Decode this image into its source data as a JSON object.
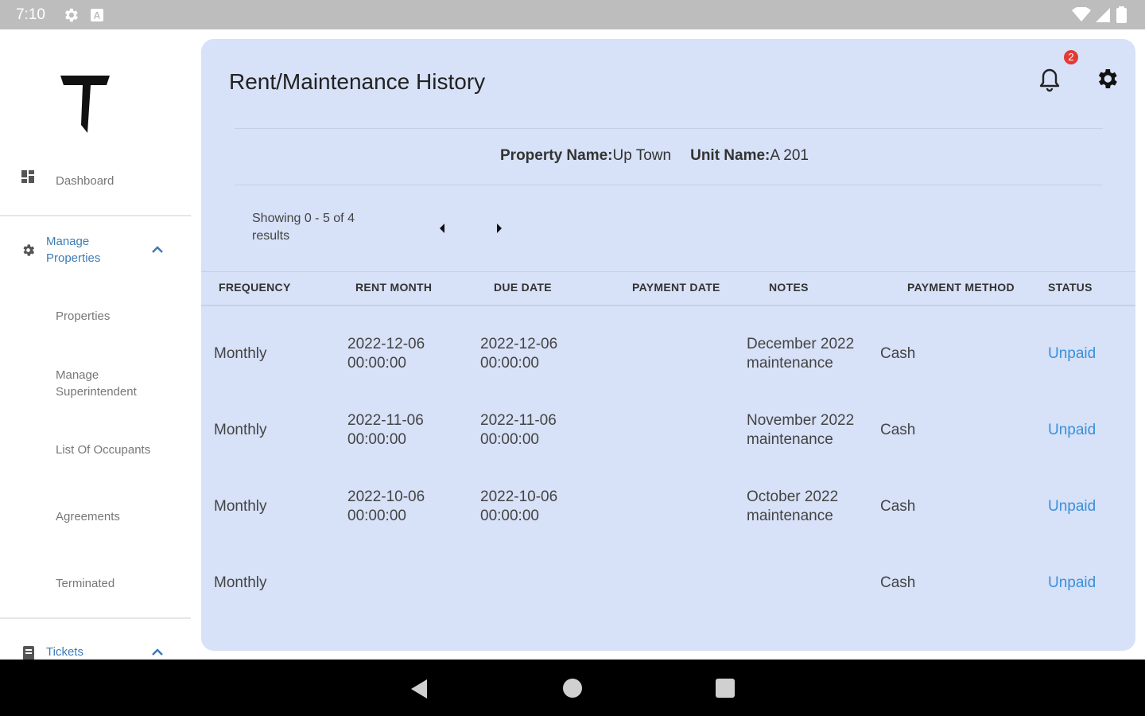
{
  "status_bar": {
    "time": "7:10"
  },
  "sidebar": {
    "dashboard": "Dashboard",
    "manage_properties": "Manage Properties",
    "sub_items": [
      "Properties",
      "Manage Superintendent",
      "List Of Occupants",
      "Agreements",
      "Terminated"
    ],
    "tickets": "Tickets"
  },
  "header": {
    "title": "Rent/Maintenance History",
    "notification_count": "2"
  },
  "info": {
    "property_label": "Property Name:",
    "property_value": "Up Town",
    "unit_label": "Unit Name:",
    "unit_value": "A 201"
  },
  "pagination": {
    "showing": "Showing 0 - 5 of 4 results"
  },
  "table": {
    "columns": [
      "FREQUENCY",
      "RENT MONTH",
      "DUE DATE",
      "PAYMENT DATE",
      "NOTES",
      "PAYMENT METHOD",
      "STATUS"
    ],
    "rows": [
      {
        "frequency": "Monthly",
        "rent_month": "2022-12-06 00:00:00",
        "due_date": "2022-12-06 00:00:00",
        "payment_date": "",
        "notes": "December 2022 maintenance",
        "method": "Cash",
        "status": "Unpaid"
      },
      {
        "frequency": "Monthly",
        "rent_month": "2022-11-06 00:00:00",
        "due_date": "2022-11-06 00:00:00",
        "payment_date": "",
        "notes": "November 2022 maintenance",
        "method": "Cash",
        "status": "Unpaid"
      },
      {
        "frequency": "Monthly",
        "rent_month": "2022-10-06 00:00:00",
        "due_date": "2022-10-06 00:00:00",
        "payment_date": "",
        "notes": "October 2022 maintenance",
        "method": "Cash",
        "status": "Unpaid"
      },
      {
        "frequency": "Monthly",
        "rent_month": "",
        "due_date": "",
        "payment_date": "",
        "notes": "",
        "method": "Cash",
        "status": "Unpaid"
      }
    ]
  },
  "colors": {
    "panel": "#d7e1f7",
    "link": "#3b8fd9",
    "nav_active": "#3d7bb8",
    "badge": "#e53935"
  }
}
